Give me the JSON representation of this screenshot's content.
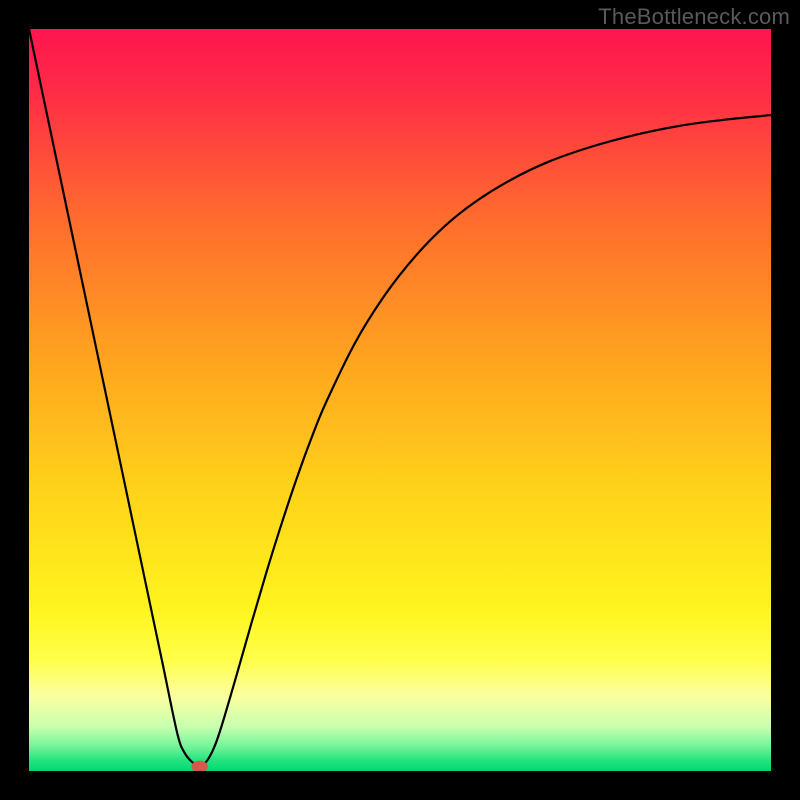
{
  "watermark": "TheBottleneck.com",
  "chart_data": {
    "type": "line",
    "title": "",
    "xlabel": "",
    "ylabel": "",
    "xlim": [
      0,
      100
    ],
    "ylim": [
      0,
      100
    ],
    "gradient_stops": [
      {
        "offset": 0,
        "color": "#ff1550"
      },
      {
        "offset": 0.08,
        "color": "#ff2a47"
      },
      {
        "offset": 0.25,
        "color": "#ff6a2e"
      },
      {
        "offset": 0.45,
        "color": "#ffa51f"
      },
      {
        "offset": 0.62,
        "color": "#ffd21a"
      },
      {
        "offset": 0.78,
        "color": "#fff41e"
      },
      {
        "offset": 0.85,
        "color": "#ffff4a"
      },
      {
        "offset": 0.9,
        "color": "#faffa0"
      },
      {
        "offset": 0.94,
        "color": "#c8ffb0"
      },
      {
        "offset": 0.965,
        "color": "#7bf59b"
      },
      {
        "offset": 0.985,
        "color": "#26e47f"
      },
      {
        "offset": 1.0,
        "color": "#00d873"
      }
    ],
    "series": [
      {
        "name": "bottleneck-curve",
        "color": "#000000",
        "x": [
          0,
          2,
          4,
          6,
          8,
          10,
          12,
          14,
          16,
          18,
          20,
          21,
          22,
          23,
          24,
          25,
          26,
          28,
          30,
          32,
          34,
          36,
          38,
          40,
          44,
          48,
          52,
          56,
          60,
          65,
          70,
          76,
          82,
          88,
          94,
          100
        ],
        "y": [
          100,
          90.5,
          81,
          71.5,
          62,
          52.5,
          43,
          33.5,
          24,
          14.5,
          5,
          2.4,
          1.2,
          0.6,
          1.4,
          3.3,
          6.2,
          13.0,
          20.0,
          26.8,
          33.2,
          39.2,
          44.7,
          49.6,
          57.8,
          64.2,
          69.3,
          73.4,
          76.6,
          79.7,
          82.1,
          84.2,
          85.8,
          87.0,
          87.8,
          88.4
        ]
      }
    ],
    "marker": {
      "x": 23,
      "y": 0.6,
      "rx": 1.1,
      "ry": 0.8,
      "color": "#d15a4a"
    }
  }
}
